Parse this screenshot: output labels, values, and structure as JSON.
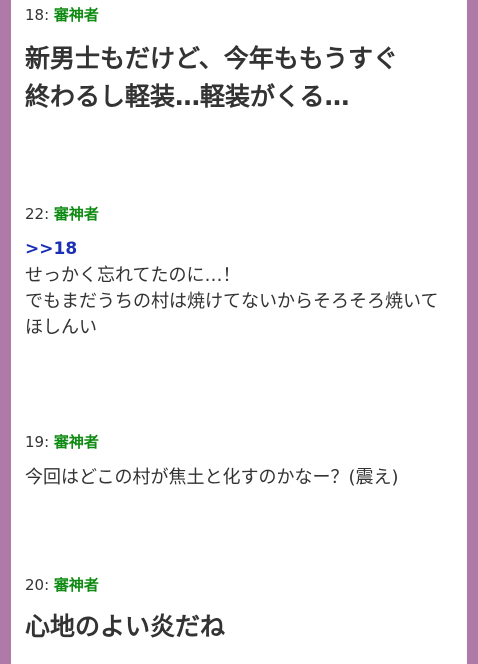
{
  "posts": [
    {
      "number": "18:",
      "author": "審神者",
      "lines": [
        "新男士もだけど、今年ももうすぐ",
        "終わるし軽装…軽装がくる…"
      ]
    },
    {
      "number": "22:",
      "author": "審神者",
      "anchor": ">>18",
      "lines": [
        "せっかく忘れてたのに…！",
        "でもまだうちの村は焼けてないからそろそろ焼いて",
        "ほしんい"
      ]
    },
    {
      "number": "19:",
      "author": "審神者",
      "lines": [
        "今回はどこの村が焦土と化すのかなー？(震え)"
      ]
    },
    {
      "number": "20:",
      "author": "審神者",
      "lines": [
        "心地のよい炎だね"
      ]
    }
  ],
  "colors": {
    "frame": "#b07aa8",
    "author_name": "#0f8a12",
    "anchor_link": "#1a2fb5",
    "body_text": "#333333"
  }
}
